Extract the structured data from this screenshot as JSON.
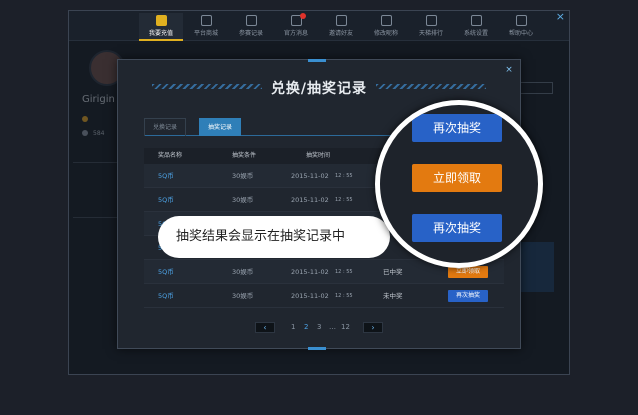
{
  "nav": [
    {
      "label": "我要充值",
      "icon": "shield-icon",
      "active": true
    },
    {
      "label": "平台商城",
      "icon": "store-icon"
    },
    {
      "label": "参赛记录",
      "icon": "record-icon"
    },
    {
      "label": "官方消息",
      "icon": "message-icon",
      "badge": true
    },
    {
      "label": "邀请好友",
      "icon": "invite-icon"
    },
    {
      "label": "修改昵称",
      "icon": "edit-icon"
    },
    {
      "label": "天梯排行",
      "icon": "ranking-icon"
    },
    {
      "label": "系统设置",
      "icon": "settings-icon"
    },
    {
      "label": "帮助中心",
      "icon": "help-icon"
    }
  ],
  "app": {
    "close": "×",
    "username": "Girigin",
    "partial_value": "584"
  },
  "modal": {
    "title": "兑换/抽奖记录",
    "close": "×",
    "tabs": [
      "兑换记录",
      "抽奖记录"
    ],
    "active_tab": 1,
    "columns": [
      "奖品名称",
      "抽奖条件",
      "抽奖时间"
    ],
    "rows": [
      {
        "prize": "5Q币",
        "cond": "30娱币",
        "date": "2015-11-02",
        "time": "12 : 55",
        "status": "",
        "action": ""
      },
      {
        "prize": "5Q币",
        "cond": "30娱币",
        "date": "2015-11-02",
        "time": "12 : 55",
        "status": "",
        "action": ""
      },
      {
        "prize": "5Q币",
        "cond": "30娱币",
        "date": "2015-11-02",
        "time": "12 : 55",
        "status": "",
        "action": ""
      },
      {
        "prize": "5Q币",
        "cond": "30娱币",
        "date": "2015-11-02",
        "time": "12 : 55",
        "status": "",
        "action": ""
      },
      {
        "prize": "5Q币",
        "cond": "30娱币",
        "date": "2015-11-02",
        "time": "12 : 55",
        "status": "已中奖",
        "action": "立即领取"
      },
      {
        "prize": "5Q币",
        "cond": "30娱币",
        "date": "2015-11-02",
        "time": "12 : 55",
        "status": "未中奖",
        "action": "再次抽奖"
      }
    ],
    "pager": {
      "prev": "‹",
      "next": "›",
      "pages": [
        "1",
        "2",
        "3",
        "…",
        "12"
      ],
      "current": "2"
    }
  },
  "bubble": {
    "text": "抽奖结果会显示在抽奖记录中"
  },
  "spotlight": {
    "buttons": [
      "再次抽奖",
      "立即领取",
      "再次抽奖"
    ]
  },
  "colors": {
    "accent_blue": "#2862c7",
    "accent_orange": "#e37a10",
    "nav_active": "#e0b020",
    "link": "#4da3e6"
  }
}
